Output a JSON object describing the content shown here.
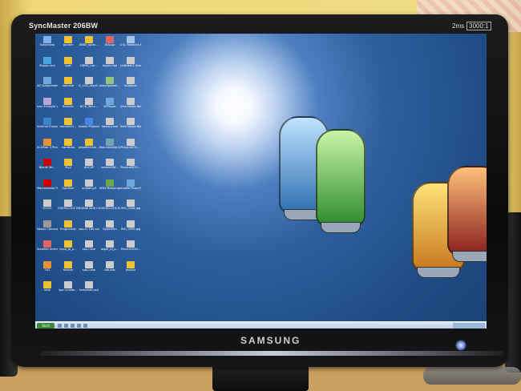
{
  "monitor": {
    "model_label": "SyncMaster 206BW",
    "badge_speed": "2ms",
    "badge_ratio": "3000:1",
    "brand_logo": "SAMSUNG"
  },
  "desktop": {
    "taskbar": {
      "start_label": "Start"
    },
    "icons": [
      {
        "label": "Subjectivo",
        "color": "#7fb0e8"
      },
      {
        "label": "guiden",
        "color": "#f1c232"
      },
      {
        "label": "8860_splas…",
        "color": "#f1c232"
      },
      {
        "label": "ToSoup",
        "color": "#e06666"
      },
      {
        "label": "U.S. Robotics Easy Config…",
        "color": "#9fc5e8"
      },
      {
        "label": "Skype.com",
        "color": "#4aa3df"
      },
      {
        "label": "ipak",
        "color": "#f1c232"
      },
      {
        "label": "DBM4_nar…",
        "color": "#cccccc"
      },
      {
        "label": "hayes.mpl",
        "color": "#cccccc"
      },
      {
        "label": "Untitled-1.html",
        "color": "#cccccc"
      },
      {
        "label": "AG Bulgarization",
        "color": "#6fa8dc"
      },
      {
        "label": "koovedi",
        "color": "#f1c232"
      },
      {
        "label": "G_LCD_cssyll…",
        "color": "#cccccc"
      },
      {
        "label": "installpowell…",
        "color": "#93c47d"
      },
      {
        "label": "isOpaver",
        "color": "#cccccc"
      },
      {
        "label": "Icon Entstyle Vulcan",
        "color": "#b4a7d6"
      },
      {
        "label": "Blumen",
        "color": "#f1c232"
      },
      {
        "label": "RC3I_3ecv…",
        "color": "#cccccc"
      },
      {
        "label": "VPPlayer",
        "color": "#6fa8dc"
      },
      {
        "label": "Sem Nesta Bolgara 1/2 Ur-I",
        "color": "#cccccc"
      },
      {
        "label": "Internet Explorer",
        "color": "#3d85c6"
      },
      {
        "label": "nemeti00…",
        "color": "#f1c232"
      },
      {
        "label": "Adobe Photosh…",
        "color": "#4a86e8"
      },
      {
        "label": "latency.exe",
        "color": "#cccccc"
      },
      {
        "label": "Sem Nesta Bolgara 1/2 Ur-I",
        "color": "#cccccc"
      },
      {
        "label": "ACDSee 9 Photo…",
        "color": "#e69138"
      },
      {
        "label": "namfices",
        "color": "#f1c232"
      },
      {
        "label": "adobflichem…",
        "color": "#f1c232"
      },
      {
        "label": "Macromedia Dreamwea…",
        "color": "#76a5af"
      },
      {
        "label": "Picture0071…",
        "color": "#cccccc"
      },
      {
        "label": "Bionik Tel…",
        "color": "#cc0000"
      },
      {
        "label": "My2",
        "color": "#f1c232"
      },
      {
        "label": "AHCAP",
        "color": "#cccccc"
      },
      {
        "label": "nemteil06…",
        "color": "#cccccc"
      },
      {
        "label": "Picture0071…",
        "color": "#cccccc"
      },
      {
        "label": "Macromedia Flash 8",
        "color": "#cc0000"
      },
      {
        "label": "Ogulhan",
        "color": "#f1c232"
      },
      {
        "label": "ocaber.gif",
        "color": "#cccccc"
      },
      {
        "label": "MSN Messenger",
        "color": "#6aa84f"
      },
      {
        "label": "mobile PhoneTools",
        "color": "#6fa8dc"
      },
      {
        "label": "ROOO",
        "color": "#cccccc"
      },
      {
        "label": "OVERCLOCK REDRI NKO…",
        "color": "#cccccc"
      },
      {
        "label": "BURAK NUR CORRESI.mp3",
        "color": "#cccccc"
      },
      {
        "label": "OVERCLOCK REDRI NKI…",
        "color": "#cccccc"
      },
      {
        "label": "IMG_0446.jpg",
        "color": "#cccccc"
      },
      {
        "label": "Nexus Camera F…",
        "color": "#999999"
      },
      {
        "label": "Programlar",
        "color": "#f1c232"
      },
      {
        "label": "spo-rc 180.cpi",
        "color": "#cccccc"
      },
      {
        "label": "SpeedFan",
        "color": "#cccccc"
      },
      {
        "label": "IMG_0999.jpg",
        "color": "#cccccc"
      },
      {
        "label": "Spreden Intere…",
        "color": "#e06666"
      },
      {
        "label": "kapo_pi_p…",
        "color": "#f1c232"
      },
      {
        "label": "spo-r.exe",
        "color": "#cccccc"
      },
      {
        "label": "aspel_pi_p…",
        "color": "#cccccc"
      },
      {
        "label": "Picture1045…",
        "color": "#cccccc"
      },
      {
        "label": "T&T",
        "color": "#e69138"
      },
      {
        "label": "Yollalar",
        "color": "#f1c232"
      },
      {
        "label": "spo-r.exe",
        "color": "#cccccc"
      },
      {
        "label": "fab.exe",
        "color": "#cccccc"
      },
      {
        "label": "asmlar",
        "color": "#f1c232"
      },
      {
        "label": "leda",
        "color": "#f1c232"
      },
      {
        "label": "spo-r.mode…",
        "color": "#cccccc"
      },
      {
        "label": "template.ps4",
        "color": "#cccccc"
      }
    ]
  },
  "wallpaper": {
    "jars": [
      {
        "color_top": "#bfe3ff",
        "color_bottom": "#2f6fb3"
      },
      {
        "color_top": "#c9f5a6",
        "color_bottom": "#2e8b2e"
      },
      {
        "color_top": "#ffe27a",
        "color_bottom": "#c8781c"
      },
      {
        "color_top": "#ffc07a",
        "color_bottom": "#8a1f1f"
      }
    ]
  }
}
